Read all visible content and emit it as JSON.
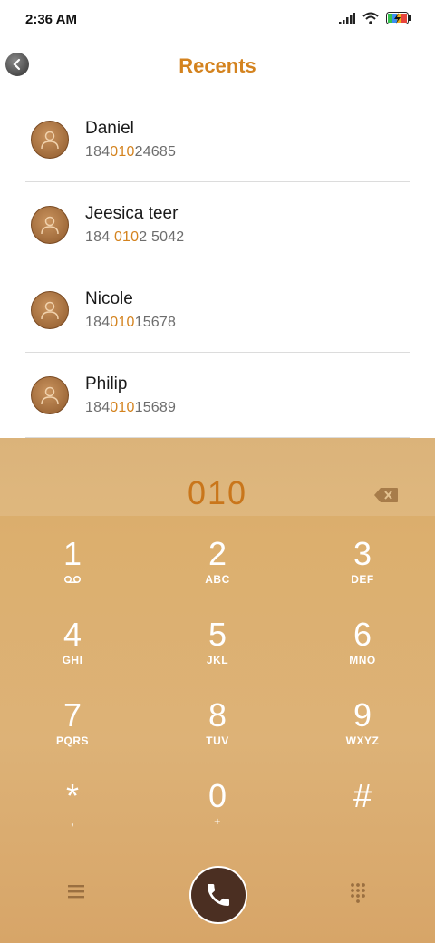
{
  "status_bar": {
    "time": "2:36 AM"
  },
  "header": {
    "title": "Recents"
  },
  "contacts": [
    {
      "name": "Daniel",
      "number_pre": "184",
      "number_match": "010",
      "number_post": "24685"
    },
    {
      "name": "Jeesica teer",
      "number_pre": "184 ",
      "number_match": "010",
      "number_post": "2 5042"
    },
    {
      "name": "Nicole",
      "number_pre": "184",
      "number_match": "010",
      "number_post": "15678"
    },
    {
      "name": "Philip",
      "number_pre": "184",
      "number_match": "010",
      "number_post": "15689"
    }
  ],
  "dialer": {
    "input": "010",
    "keys": [
      {
        "digit": "1",
        "letters": ""
      },
      {
        "digit": "2",
        "letters": "ABC"
      },
      {
        "digit": "3",
        "letters": "DEF"
      },
      {
        "digit": "4",
        "letters": "GHI"
      },
      {
        "digit": "5",
        "letters": "JKL"
      },
      {
        "digit": "6",
        "letters": "MNO"
      },
      {
        "digit": "7",
        "letters": "PQRS"
      },
      {
        "digit": "8",
        "letters": "TUV"
      },
      {
        "digit": "9",
        "letters": "WXYZ"
      },
      {
        "digit": "*",
        "letters": ","
      },
      {
        "digit": "0",
        "letters": "+"
      },
      {
        "digit": "#",
        "letters": ""
      }
    ]
  },
  "colors": {
    "accent": "#d4831f",
    "call_button": "#4b2f22",
    "dialer_bg": "#dcaf6e"
  },
  "icons": {
    "back": "back-arrow-icon",
    "voicemail": "voicemail-icon",
    "backspace": "backspace-icon",
    "menu": "menu-icon",
    "call": "phone-icon",
    "dialpad": "dialpad-icon"
  }
}
